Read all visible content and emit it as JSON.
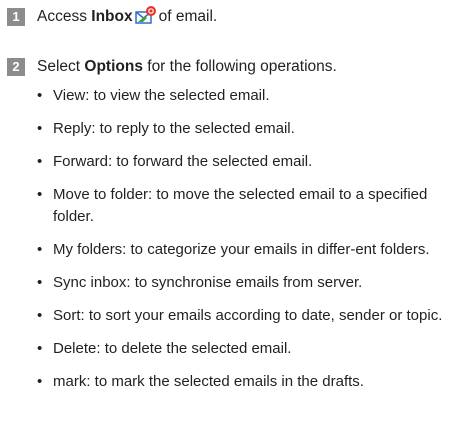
{
  "steps": [
    {
      "number": "1",
      "text_before": "Access ",
      "bold": "Inbox",
      "icon": "inbox-email-icon",
      "text_after": "of email."
    },
    {
      "number": "2",
      "text_before": "Select ",
      "bold": "Options",
      "text_after": " for the following operations."
    }
  ],
  "operations": [
    "View: to view the selected email.",
    "Reply: to reply to the selected email.",
    "Forward: to forward the selected email.",
    "Move to folder: to move the selected email to a specified folder.",
    "My folders: to categorize your emails in differ-ent folders.",
    "Sync inbox: to synchronise emails from server.",
    "Sort: to sort your emails according to date, sender or topic.",
    "Delete: to delete the selected email.",
    "mark: to mark the selected emails in the drafts."
  ],
  "colors": {
    "step_badge": "#8c8c8c",
    "text": "#231f20",
    "icon_red": "#e8322b",
    "icon_green": "#3aa34a",
    "icon_blue": "#2f6fc9"
  }
}
